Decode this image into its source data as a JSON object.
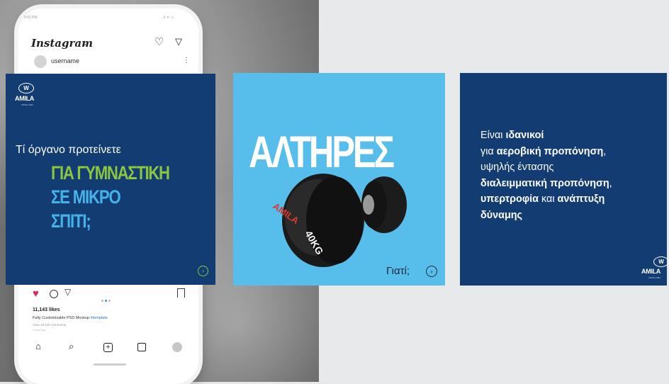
{
  "phone": {
    "status_time": "9:41 PM",
    "status_icons": "..ıl ᯤ ▭",
    "app_name": "Instagram",
    "app_chevron": "⌄",
    "username": "username",
    "more": "⋮",
    "likes": "11,143 likes",
    "caption": "Fully Customizable PSD Mockup",
    "hashtag": "#template",
    "view_comments": "View all 325 comments",
    "time_ago": "4 days ago"
  },
  "brand": {
    "mark": "W",
    "name": "AMILA",
    "sub": "SINCE 1984"
  },
  "card1": {
    "question": "Τί όργανο προτείνετε",
    "line1": "ΓΙΑ ΓΥΜΝΑΣΤΙΚΗ",
    "line2": "ΣΕ ΜΙΚΡΟ",
    "line3": "ΣΠΙΤΙ;",
    "arrow": "›"
  },
  "card2": {
    "title": "ΑΛΤΗΡΕΣ",
    "why": "Γιατί;",
    "arrow": "›",
    "dumbbell_brand": "AMILA",
    "dumbbell_weight": "40KG"
  },
  "card3": {
    "p1": "Είναι ",
    "b1": "ιδανικοί",
    "p2": "για ",
    "b2": "αεροβική προπόνηση",
    "p3": ",",
    "p4": "υψηλής έντασης",
    "b3": "διαλειμματική προπόνηση",
    "p5": ",",
    "b4": "υπερτροφία",
    "p6": " και ",
    "b5": "ανάπτυξη",
    "b6": "δύναμης"
  },
  "colors": {
    "navy": "#123c72",
    "green": "#8cc63f",
    "light_blue": "#45b3e9",
    "sky": "#57bdea",
    "like_red": "#e0245e"
  }
}
